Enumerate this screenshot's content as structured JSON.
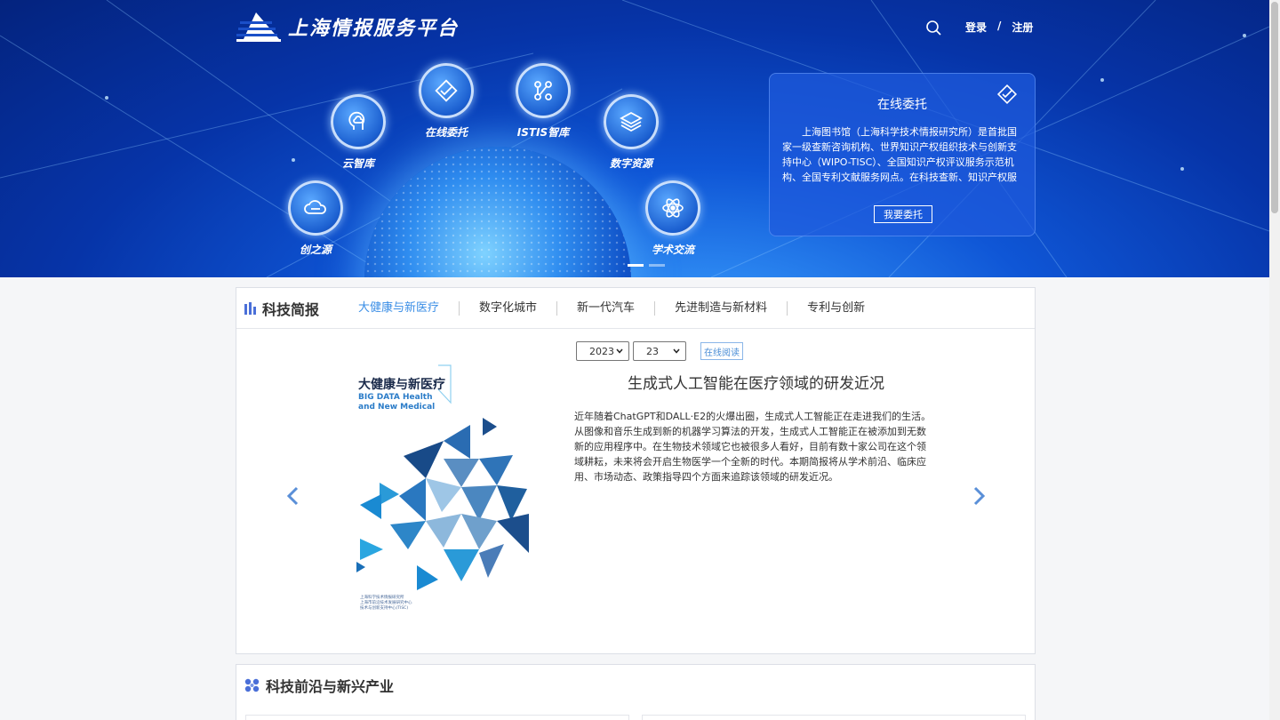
{
  "header": {
    "site_title": "上海情报服务平台",
    "login_label": "登录",
    "separator": "/",
    "register_label": "注册"
  },
  "hero": {
    "services": [
      {
        "label": "云智库",
        "icon": "brain-cloud-icon"
      },
      {
        "label": "在线委托",
        "icon": "handshake-icon"
      },
      {
        "label": "ISTIS智库",
        "icon": "network-nodes-icon"
      },
      {
        "label": "数字资源",
        "icon": "layers-icon"
      },
      {
        "label": "创之源",
        "icon": "cloud-icon"
      },
      {
        "label": "学术交流",
        "icon": "atom-icon"
      }
    ],
    "carousel_active_index": 0
  },
  "consign": {
    "title": "在线委托",
    "text": "上海图书馆（上海科学技术情报研究所）是首批国家一级查新咨询机构、世界知识产权组织技术与创新支持中心（WIPO-TISC）、全国知识产权评议服务示范机构、全国专利文献服务网点。在科技查新、知识产权服务、科...",
    "button_label": "我要委托"
  },
  "brief": {
    "title": "科技简报",
    "tabs": [
      {
        "label": "大健康与新医疗",
        "active": true
      },
      {
        "label": "数字化城市",
        "active": false
      },
      {
        "label": "新一代汽车",
        "active": false
      },
      {
        "label": "先进制造与新材料",
        "active": false
      },
      {
        "label": "专利与创新",
        "active": false
      }
    ],
    "year_value": "2023",
    "issue_value": "23",
    "read_online_label": "在线阅读",
    "cover": {
      "title": "大健康与新医疗",
      "subtitle_line1": "BIG DATA Health",
      "subtitle_line2": "and New Medical",
      "footer_line1": "上海科学技术情报研究所",
      "footer_line2": "上海市前沿技术发展研究中心",
      "footer_line3": "技术与创新支持中心(TISC)"
    },
    "article_title": "生成式人工智能在医疗领域的研发近况",
    "article_body": "近年随着ChatGPT和DALL·E2的火爆出圈，生成式人工智能正在走进我们的生活。从图像和音乐生成到新的机器学习算法的开发，生成式人工智能正在被添加到无数新的应用程序中。在生物技术领域它也被很多人看好，目前有数十家公司在这个领域耕耘，未来将会开启生物医学一个全新的时代。本期简报将从学术前沿、临床应用、市场动态、政策指导四个方面来追踪该领域的研发近况。"
  },
  "frontier": {
    "title": "科技前沿与新兴产业"
  },
  "colors": {
    "accent": "#3a8ee6",
    "hero_dark": "#04237e",
    "hero_mid": "#0f56d6",
    "brief_icon": "#4a6fd8"
  }
}
